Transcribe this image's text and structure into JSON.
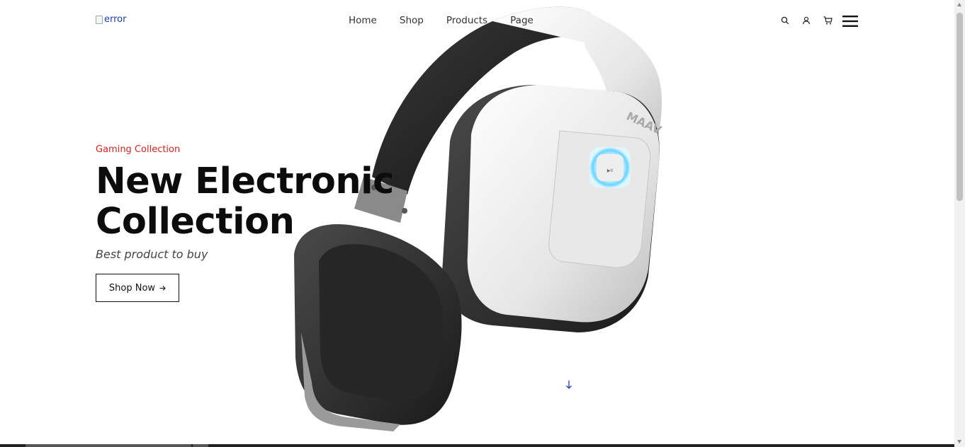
{
  "header": {
    "logo_alt": "error",
    "nav": [
      "Home",
      "Shop",
      "Products",
      "Page"
    ],
    "icons": [
      "search-icon",
      "user-icon",
      "cart-icon",
      "menu-icon"
    ]
  },
  "hero": {
    "kicker": "Gaming Collection",
    "title_line1": "New Electronic",
    "title_line2": "Collection",
    "subtitle": "Best product to buy",
    "button_label": "Shop Now",
    "button_icon": "arrow-right-icon",
    "scroll_icon": "arrow-down-icon",
    "image": "headphones-image",
    "accent_color": "#e0201b"
  }
}
